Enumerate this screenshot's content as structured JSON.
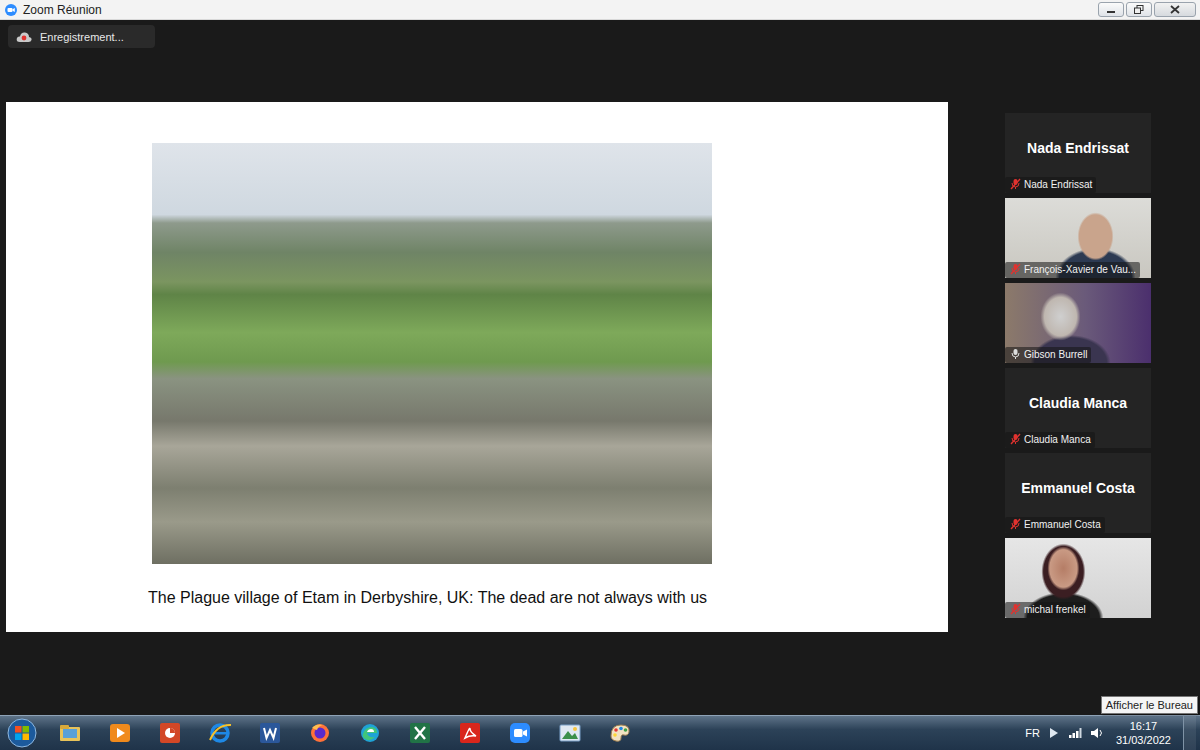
{
  "window": {
    "title": "Zoom Réunion"
  },
  "recording": {
    "label": "Enregistrement..."
  },
  "slide": {
    "caption": "The Plague village of Etam in Derbyshire, UK: The dead are not always with us"
  },
  "participants": [
    {
      "kind": "avatar",
      "name": "Nada Endrissat",
      "label": "Nada Endrissat",
      "muted": true,
      "speaking": false
    },
    {
      "kind": "video",
      "label": "François-Xavier de Vau...",
      "muted": true,
      "speaking": false
    },
    {
      "kind": "video",
      "label": "Gibson Burrell",
      "muted": false,
      "speaking": true
    },
    {
      "kind": "avatar",
      "name": "Claudia Manca",
      "label": "Claudia Manca",
      "muted": true,
      "speaking": false
    },
    {
      "kind": "avatar",
      "name": "Emmanuel Costa",
      "label": "Emmanuel Costa",
      "muted": true,
      "speaking": false
    },
    {
      "kind": "video",
      "label": "michal frenkel",
      "muted": true,
      "speaking": false
    }
  ],
  "taskbar": {
    "language": "FR",
    "time": "16:17",
    "date": "31/03/2022"
  },
  "tooltip": {
    "text": "Afficher le Bureau"
  }
}
